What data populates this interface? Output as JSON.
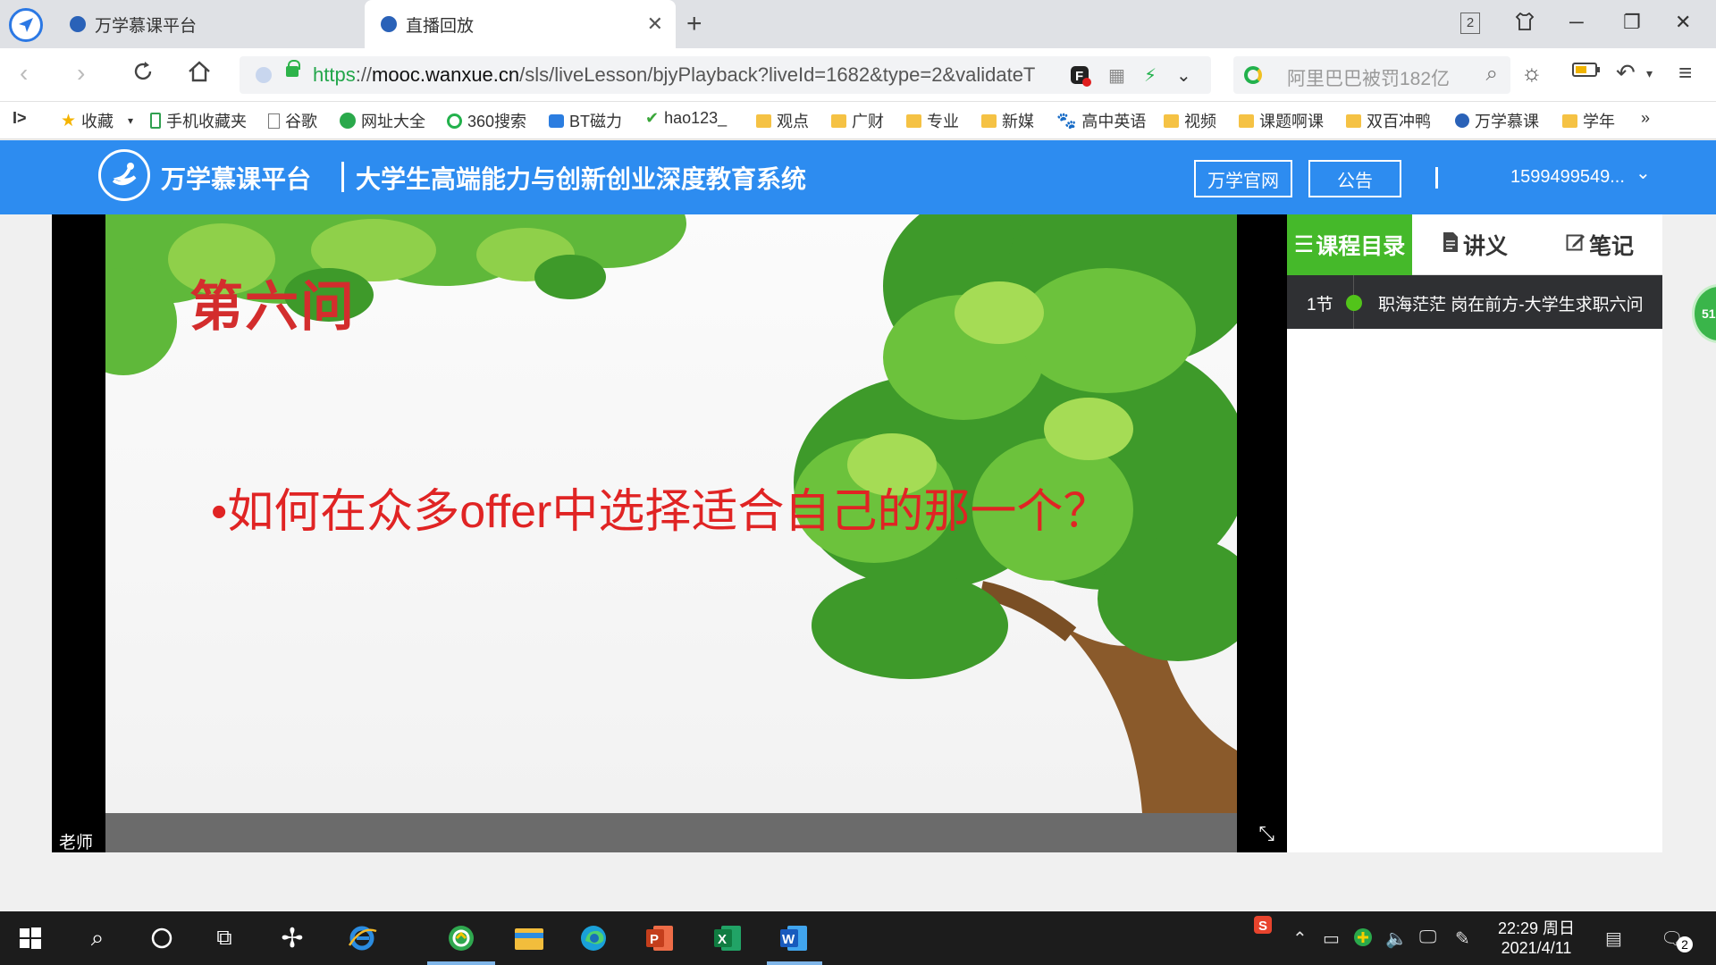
{
  "browser": {
    "tabs": [
      {
        "title": "万学慕课平台"
      },
      {
        "title": "直播回放"
      }
    ],
    "tab_count": "2",
    "url": {
      "scheme": "https",
      "host_prefix": "://",
      "host": "mooc.wanxue.cn",
      "path": "/sls/liveLesson/bjyPlayback?liveId=1682&type=2&validateT"
    },
    "search_placeholder": "阿里巴巴被罚182亿",
    "bookmarks": [
      {
        "label": "收藏",
        "icon": "star-icon"
      },
      {
        "label": "手机收藏夹",
        "icon": "phone-icon"
      },
      {
        "label": "谷歌",
        "icon": "page-icon"
      },
      {
        "label": "网址大全",
        "icon": "plus-green-icon"
      },
      {
        "label": "360搜索",
        "icon": "360-icon"
      },
      {
        "label": "BT磁力",
        "icon": "bt-icon"
      },
      {
        "label": "hao123_",
        "icon": "hao-icon"
      },
      {
        "label": "观点",
        "icon": "folder-icon"
      },
      {
        "label": "广财",
        "icon": "folder-icon"
      },
      {
        "label": "专业",
        "icon": "folder-icon"
      },
      {
        "label": "新媒",
        "icon": "folder-icon"
      },
      {
        "label": "高中英语",
        "icon": "paw-icon"
      },
      {
        "label": "视频",
        "icon": "folder-icon"
      },
      {
        "label": "课题啊课",
        "icon": "folder-icon"
      },
      {
        "label": "双百冲鸭",
        "icon": "folder-icon"
      },
      {
        "label": "万学慕课",
        "icon": "site-icon"
      },
      {
        "label": "学年",
        "icon": "folder-icon"
      }
    ],
    "more_bookmarks": "»"
  },
  "site": {
    "brand": "万学慕课平台",
    "subtitle": "大学生高端能力与创新创业深度教育系统",
    "official_site_btn": "万学官网",
    "notice_btn": "公告",
    "username": "1599499549..."
  },
  "video": {
    "slide_heading": "第六问",
    "slide_bullet": "•如何在众多offer中选择适合自己的那一个？",
    "speaker_label": "老师"
  },
  "side_panel": {
    "tabs": [
      {
        "label": "课程目录",
        "icon": "list-icon",
        "active": true
      },
      {
        "label": "讲义",
        "icon": "document-icon",
        "active": false
      },
      {
        "label": "笔记",
        "icon": "edit-icon",
        "active": false
      }
    ],
    "lessons": [
      {
        "number": "1节",
        "title": "职海茫茫 岗在前方-大学生求职六问"
      }
    ],
    "float_badge": "51"
  },
  "taskbar": {
    "time": "22:29 周日",
    "date": "2021/4/11",
    "notification_count": "2"
  },
  "colors": {
    "header_blue": "#2d8cf0",
    "active_tab_green": "#45b92a",
    "slide_red": "#e02424"
  }
}
